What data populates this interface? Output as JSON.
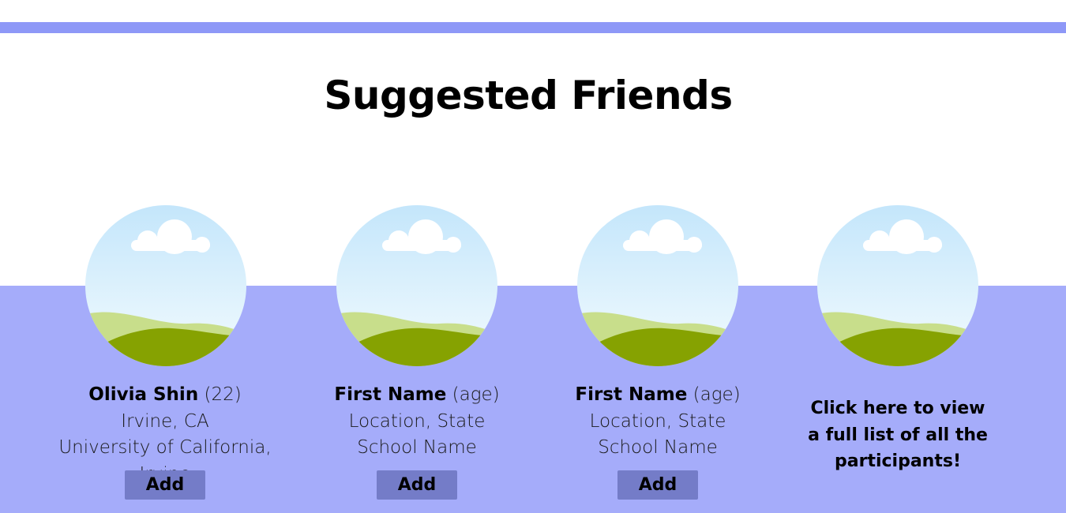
{
  "page": {
    "title": "Suggested Friends"
  },
  "friends": [
    {
      "name": "Olivia Shin",
      "age": "(22)",
      "location": "Irvine, CA",
      "school": "University of California, Irvine",
      "add_label": "Add"
    },
    {
      "name": "First Name",
      "age": "(age)",
      "location": "Location, State",
      "school": "School Name",
      "add_label": "Add"
    },
    {
      "name": "First Name",
      "age": "(age)",
      "location": "Location, State",
      "school": "School Name",
      "add_label": "Add"
    }
  ],
  "view_all": {
    "line1": "Click here to view",
    "line2": "a full list of all the",
    "line3": "participants!"
  },
  "colors": {
    "accent_bar": "#8e98f7",
    "band": "#a5acfa",
    "button": "#747cc8"
  },
  "icons": {
    "avatar": "landscape-placeholder-icon"
  }
}
